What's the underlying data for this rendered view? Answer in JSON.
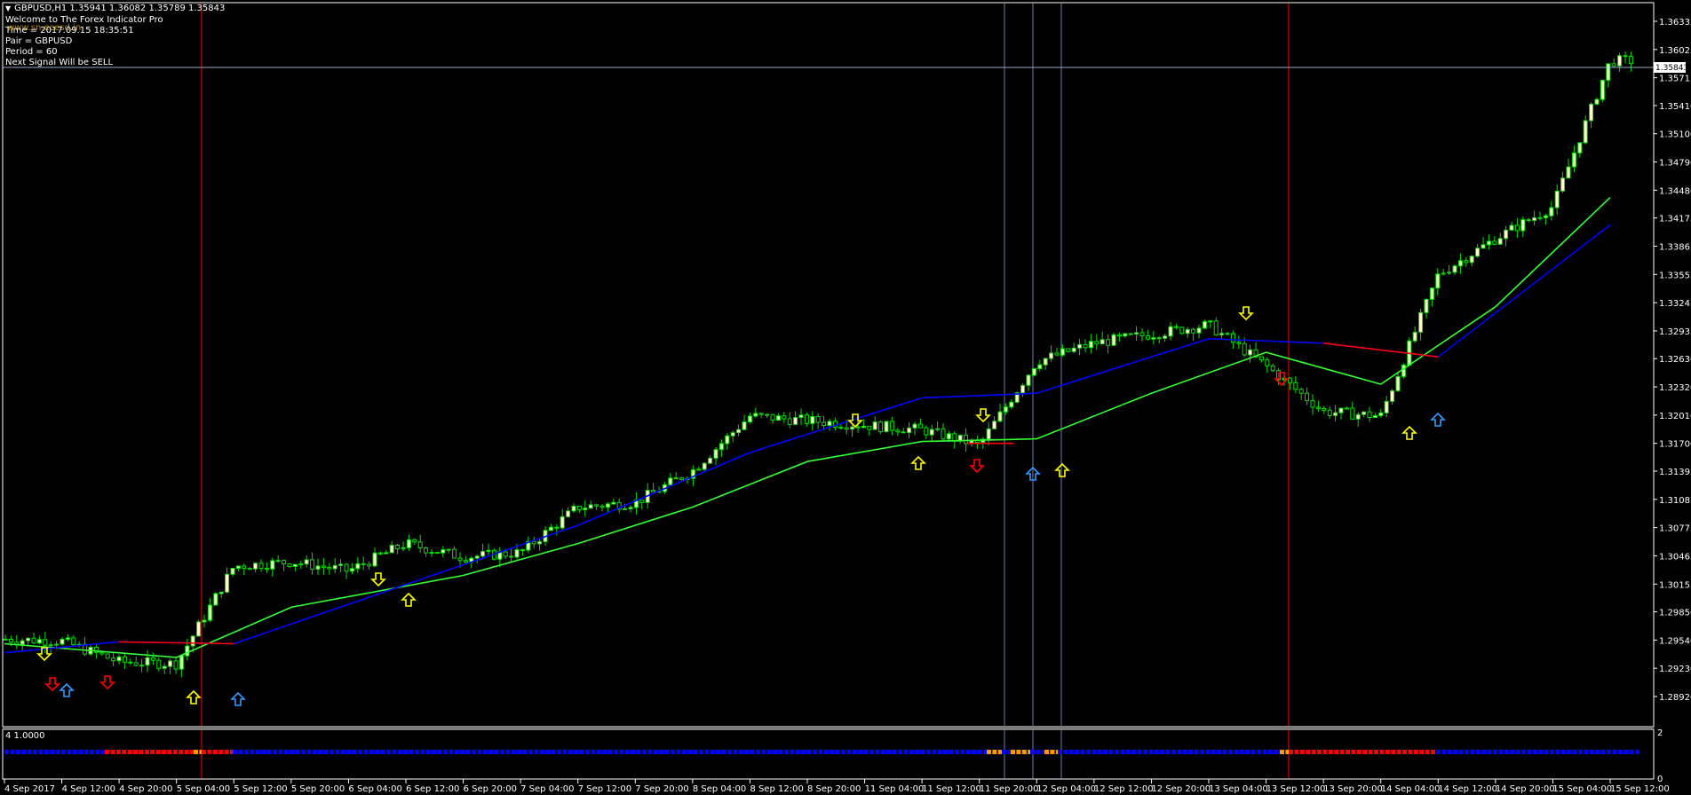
{
  "header": {
    "symbol_line": "GBPUSD,H1  1.35941 1.36082 1.35789 1.35843",
    "welcome": "Welcome to The Forex Indicator Pro",
    "watermark": "www.sn.ecesd.in",
    "time": "Time = 2017.09.15 18:35:51",
    "pair": "Pair = GBPUSD",
    "period": "Period = 60",
    "next_signal": "Next Signal Will be SELL"
  },
  "price_axis": {
    "ticks": [
      "1.36335",
      "1.36025",
      "1.35715",
      "1.35410",
      "1.35100",
      "1.34790",
      "1.34480",
      "1.34175",
      "1.33865",
      "1.33555",
      "1.33245",
      "1.32935",
      "1.32630",
      "1.32320",
      "1.32010",
      "1.31700",
      "1.31395",
      "1.31085",
      "1.30775",
      "1.30465",
      "1.30155",
      "1.29850",
      "1.29540",
      "1.29230",
      "1.28920"
    ],
    "current_price": "1.35843"
  },
  "time_axis": {
    "labels": [
      "4 Sep 2017",
      "4 Sep 12:00",
      "4 Sep 20:00",
      "5 Sep 04:00",
      "5 Sep 12:00",
      "5 Sep 20:00",
      "6 Sep 04:00",
      "6 Sep 12:00",
      "6 Sep 20:00",
      "7 Sep 04:00",
      "7 Sep 12:00",
      "7 Sep 20:00",
      "8 Sep 04:00",
      "8 Sep 12:00",
      "8 Sep 20:00",
      "11 Sep 04:00",
      "11 Sep 12:00",
      "11 Sep 20:00",
      "12 Sep 04:00",
      "12 Sep 12:00",
      "12 Sep 20:00",
      "13 Sep 04:00",
      "13 Sep 12:00",
      "13 Sep 20:00",
      "14 Sep 04:00",
      "14 Sep 12:00",
      "14 Sep 20:00",
      "15 Sep 04:00",
      "15 Sep 12:00"
    ]
  },
  "sub_window": {
    "label": "4 1.0000",
    "axis_top": "2",
    "axis_bottom": "0"
  },
  "colors": {
    "background": "#000000",
    "bull_candle": "#ffffcc",
    "candle_wick": "#00e000",
    "ma_green": "#33ff33",
    "ma_blue": "#0000ff",
    "ma_red": "#ff0000",
    "sell_arrow": "#ffff00",
    "buy_arrow": "#3399ff",
    "vline_red": "#ff0000",
    "vline_blue": "#6f7fb0",
    "hist_blue": "#0000ff",
    "hist_red": "#ff0000",
    "hist_orange": "#ff9900"
  },
  "chart_data": {
    "type": "candlestick",
    "symbol": "GBPUSD",
    "timeframe": "H1",
    "last_ohlc": {
      "open": 1.35941,
      "high": 1.36082,
      "low": 1.35789,
      "close": 1.35843
    },
    "ylim": [
      1.2892,
      1.36335
    ],
    "close_path": [
      {
        "t": "4 Sep 2017",
        "v": 1.2955
      },
      {
        "t": "4 Sep 12:00",
        "v": 1.2953
      },
      {
        "t": "4 Sep 20:00",
        "v": 1.293
      },
      {
        "t": "5 Sep 04:00",
        "v": 1.2928
      },
      {
        "t": "5 Sep 12:00",
        "v": 1.3035
      },
      {
        "t": "5 Sep 20:00",
        "v": 1.304
      },
      {
        "t": "6 Sep 04:00",
        "v": 1.303
      },
      {
        "t": "6 Sep 12:00",
        "v": 1.306
      },
      {
        "t": "6 Sep 20:00",
        "v": 1.3045
      },
      {
        "t": "7 Sep 04:00",
        "v": 1.305
      },
      {
        "t": "7 Sep 12:00",
        "v": 1.31
      },
      {
        "t": "7 Sep 20:00",
        "v": 1.3105
      },
      {
        "t": "8 Sep 04:00",
        "v": 1.314
      },
      {
        "t": "8 Sep 12:00",
        "v": 1.32
      },
      {
        "t": "8 Sep 20:00",
        "v": 1.3195
      },
      {
        "t": "11 Sep 04:00",
        "v": 1.319
      },
      {
        "t": "11 Sep 12:00",
        "v": 1.3185
      },
      {
        "t": "11 Sep 20:00",
        "v": 1.3168
      },
      {
        "t": "12 Sep 04:00",
        "v": 1.326
      },
      {
        "t": "12 Sep 12:00",
        "v": 1.328
      },
      {
        "t": "12 Sep 20:00",
        "v": 1.329
      },
      {
        "t": "13 Sep 04:00",
        "v": 1.33
      },
      {
        "t": "13 Sep 12:00",
        "v": 1.3255
      },
      {
        "t": "13 Sep 20:00",
        "v": 1.3205
      },
      {
        "t": "14 Sep 04:00",
        "v": 1.32
      },
      {
        "t": "14 Sep 12:00",
        "v": 1.3355
      },
      {
        "t": "14 Sep 20:00",
        "v": 1.3395
      },
      {
        "t": "15 Sep 04:00",
        "v": 1.343
      },
      {
        "t": "15 Sep 12:00",
        "v": 1.359
      }
    ],
    "ma_fast_green": [
      {
        "t": "4 Sep 2017",
        "v": 1.295
      },
      {
        "t": "5 Sep 04:00",
        "v": 1.2935
      },
      {
        "t": "5 Sep 20:00",
        "v": 1.299
      },
      {
        "t": "6 Sep 20:00",
        "v": 1.3025
      },
      {
        "t": "7 Sep 12:00",
        "v": 1.306
      },
      {
        "t": "8 Sep 04:00",
        "v": 1.31
      },
      {
        "t": "8 Sep 20:00",
        "v": 1.315
      },
      {
        "t": "11 Sep 12:00",
        "v": 1.3172
      },
      {
        "t": "12 Sep 04:00",
        "v": 1.3175
      },
      {
        "t": "12 Sep 20:00",
        "v": 1.3225
      },
      {
        "t": "13 Sep 12:00",
        "v": 1.327
      },
      {
        "t": "14 Sep 04:00",
        "v": 1.3235
      },
      {
        "t": "14 Sep 20:00",
        "v": 1.332
      },
      {
        "t": "15 Sep 12:00",
        "v": 1.344
      }
    ],
    "ma_slow_colored": [
      {
        "t": "4 Sep 2017",
        "v": 1.294
      },
      {
        "t": "4 Sep 20:00",
        "v": 1.2952
      },
      {
        "t": "5 Sep 12:00",
        "v": 1.295
      },
      {
        "t": "6 Sep 12:00",
        "v": 1.3015
      },
      {
        "t": "7 Sep 12:00",
        "v": 1.308
      },
      {
        "t": "8 Sep 12:00",
        "v": 1.316
      },
      {
        "t": "11 Sep 12:00",
        "v": 1.322
      },
      {
        "t": "12 Sep 04:00",
        "v": 1.3225
      },
      {
        "t": "13 Sep 04:00",
        "v": 1.3285
      },
      {
        "t": "13 Sep 20:00",
        "v": 1.328
      },
      {
        "t": "14 Sep 12:00",
        "v": 1.3265
      },
      {
        "t": "15 Sep 12:00",
        "v": 1.341
      }
    ]
  }
}
